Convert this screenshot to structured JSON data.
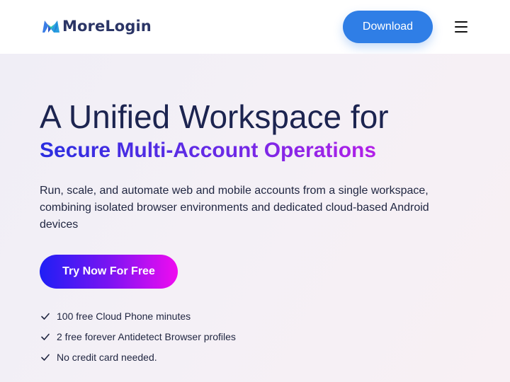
{
  "header": {
    "logo_text": "MoreLogin",
    "download_label": "Download",
    "menu_icon": "hamburger-menu-icon"
  },
  "hero": {
    "title": "A Unified Workspace for",
    "subtitle": "Secure Multi-Account Operations",
    "description": "Run, scale, and automate web and mobile accounts from a single workspace, combining isolated browser environments and dedicated cloud-based Android devices",
    "cta_label": "Try Now For Free",
    "features": [
      "100 free Cloud Phone minutes",
      "2 free forever Antidetect Browser profiles",
      "No credit card needed."
    ]
  },
  "colors": {
    "accent_blue": "#2f7ee6",
    "title_navy": "#1c2450",
    "gradient_start": "#1f1ff5",
    "gradient_end": "#f00cf0"
  }
}
